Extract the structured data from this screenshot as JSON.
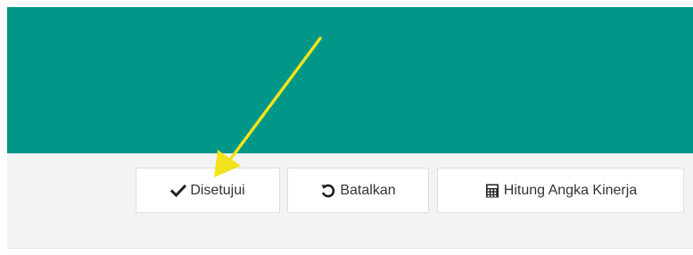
{
  "header": {
    "background_color": "#009688"
  },
  "toolbar": {
    "background_color": "#f2f3f5",
    "buttons": [
      {
        "label": "Disetujui",
        "icon": "check-icon"
      },
      {
        "label": "Batalkan",
        "icon": "undo-icon"
      },
      {
        "label": "Hitung Angka Kinerja",
        "icon": "calculator-icon"
      }
    ]
  },
  "annotation": {
    "arrow_color": "#f3e21d",
    "target": "Disetujui"
  }
}
